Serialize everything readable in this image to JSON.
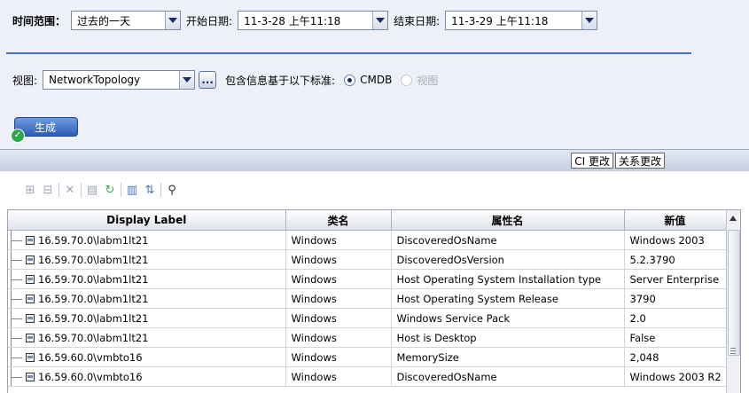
{
  "filters": {
    "time_range_label": "时间范围：",
    "time_range_value": "过去的一天",
    "start_label": "开始日期:",
    "start_value": "11-3-28 上午11:18",
    "end_label": "结束日期:",
    "end_value": "11-3-29 上午11:18",
    "view_label": "视图:",
    "view_value": "NetworkTopology",
    "browse_label": "...",
    "criteria_label": "包含信息基于以下标准:",
    "radio_cmdb": "CMDB",
    "radio_view": "视图",
    "generate_label": "生成"
  },
  "tabs": [
    {
      "label": "CI 更改",
      "active": true
    },
    {
      "label": "关系更改",
      "active": false
    }
  ],
  "toolbar_icons": [
    "expand-all-icon",
    "collapse-all-icon",
    "delete-icon",
    "properties-icon",
    "refresh-icon",
    "columns-icon",
    "sort-icon",
    "search-icon"
  ],
  "table": {
    "columns": [
      "Display Label",
      "类名",
      "属性名",
      "新值"
    ],
    "rows": [
      [
        "16.59.70.0\\labm1lt21",
        "Windows",
        "DiscoveredOsName",
        "Windows 2003"
      ],
      [
        "16.59.70.0\\labm1lt21",
        "Windows",
        "DiscoveredOsVersion",
        "5.2.3790"
      ],
      [
        "16.59.70.0\\labm1lt21",
        "Windows",
        "Host Operating System Installation type",
        "Server Enterprise"
      ],
      [
        "16.59.70.0\\labm1lt21",
        "Windows",
        "Host Operating System Release",
        "3790"
      ],
      [
        "16.59.70.0\\labm1lt21",
        "Windows",
        "Windows Service Pack",
        "2.0"
      ],
      [
        "16.59.70.0\\labm1lt21",
        "Windows",
        "Host is Desktop",
        "False"
      ],
      [
        "16.59.60.0\\vmbto16",
        "Windows",
        "MemorySize",
        "2,048"
      ],
      [
        "16.59.60.0\\vmbto16",
        "Windows",
        "DiscoveredOsName",
        "Windows 2003 R2"
      ]
    ]
  },
  "colors": {
    "accent": "#4a72c0",
    "panel_bg": "#edf0f8",
    "button": "#2c5cb8"
  }
}
